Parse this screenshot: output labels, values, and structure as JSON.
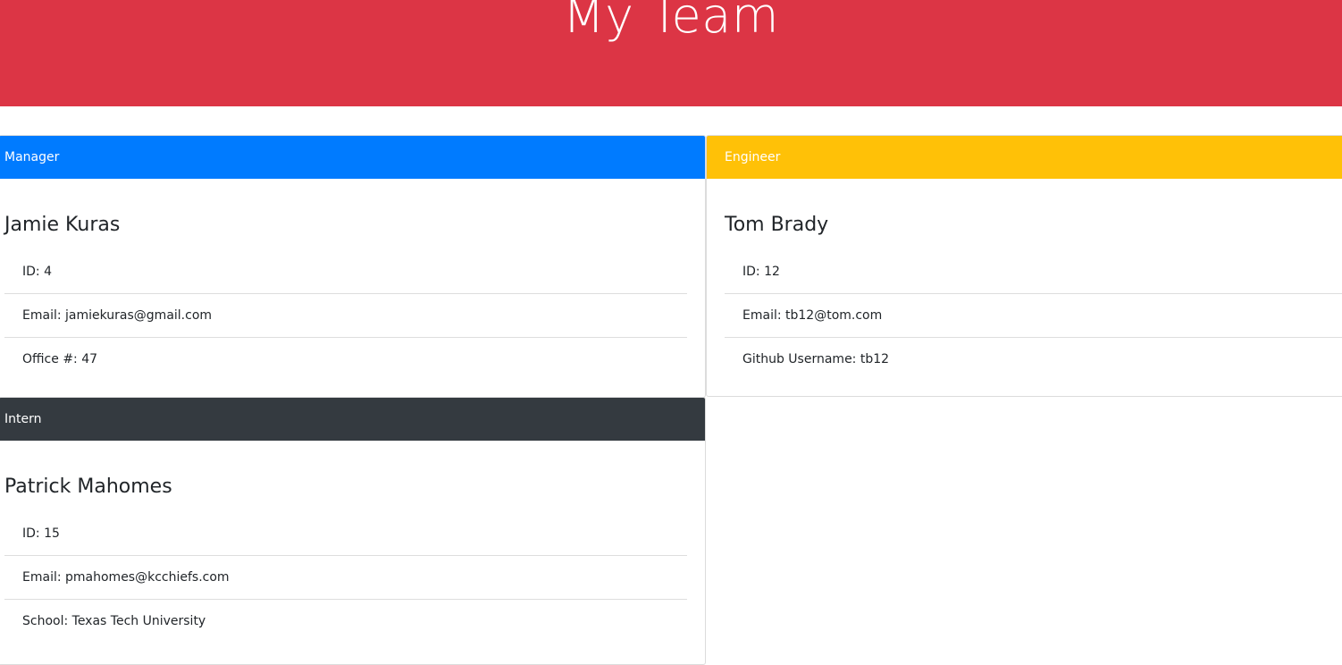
{
  "header": {
    "title": "My Team"
  },
  "colors": {
    "header_bg": "#dc3545",
    "manager": "#007bff",
    "engineer": "#ffc107",
    "intern": "#343a40"
  },
  "cards": [
    {
      "role": "Manager",
      "name": "Jamie Kuras",
      "items": [
        "ID: 4",
        "Email: jamiekuras@gmail.com",
        "Office #: 47"
      ]
    },
    {
      "role": "Engineer",
      "name": "Tom Brady",
      "items": [
        "ID: 12",
        "Email: tb12@tom.com",
        "Github Username: tb12"
      ]
    },
    {
      "role": "Intern",
      "name": "Patrick Mahomes",
      "items": [
        "ID: 15",
        "Email: pmahomes@kcchiefs.com",
        "School: Texas Tech University"
      ]
    }
  ]
}
